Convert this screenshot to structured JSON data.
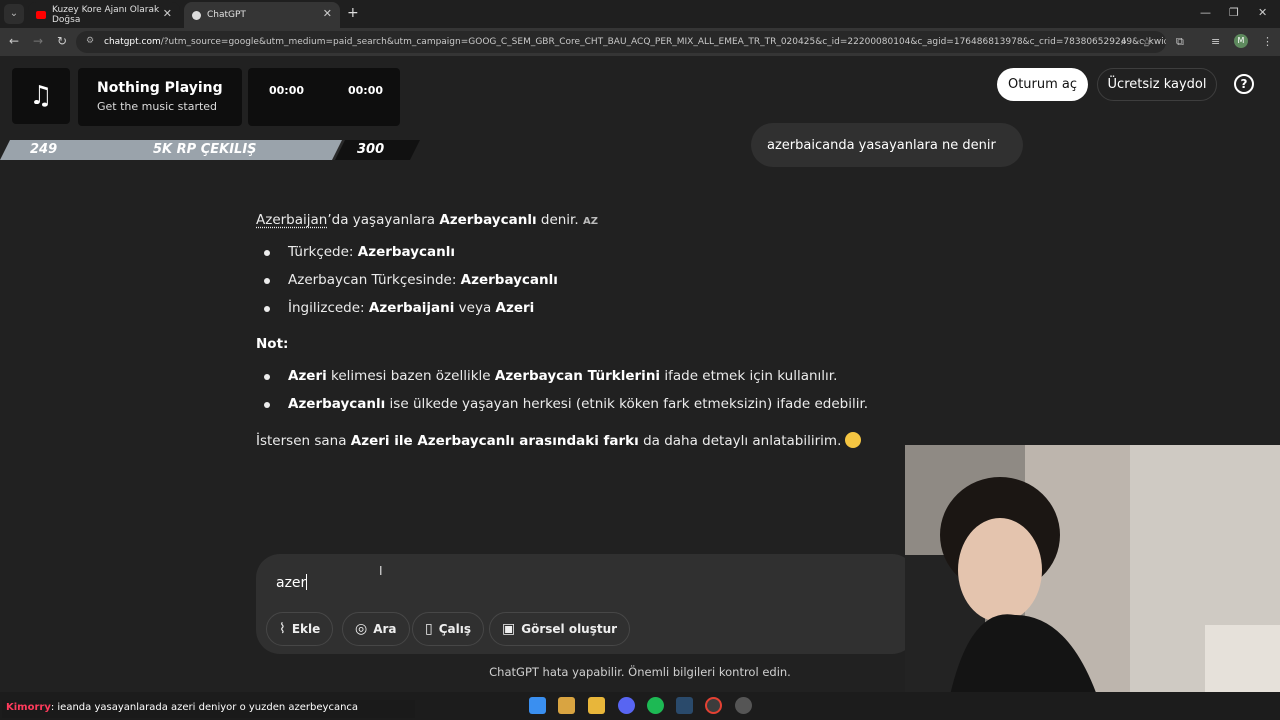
{
  "browser": {
    "tabs": [
      {
        "title": "Kuzey Kore Ajanı Olarak Doğsa",
        "close": "✕"
      },
      {
        "title": "ChatGPT",
        "close": "✕"
      }
    ],
    "new_tab": "+",
    "url_host": "chatgpt.com",
    "url_rest": "/?utm_source=google&utm_medium=paid_search&utm_campaign=GOOG_C_SEM_GBR_Core_CHT_BAU_ACQ_PER_MIX_ALL_EMEA_TR_TR_020425&c_id=22200080104&c_agid=176486813978&c_crid=783806529249&c_kwid={keyw...",
    "window_controls": {
      "minimize": "—",
      "restore": "❐",
      "close": "✕"
    },
    "avatar_letter": "M"
  },
  "music": {
    "icon": "music-note-icon",
    "title": "Nothing Playing",
    "subtitle": "Get the music started",
    "time_start": "00:00",
    "time_end": "00:00"
  },
  "rp_bar": {
    "left": "249",
    "middle": "5K RP ÇEKILIŞ",
    "right": "300",
    "progress_fraction": 0.83
  },
  "header": {
    "login": "Oturum aç",
    "signup": "Ücretsiz kaydol",
    "help": "?"
  },
  "chat": {
    "user_message": "azerbaicanda yasayanlara ne denir",
    "answer": {
      "intro_link": "Azerbaijan",
      "intro_rest1": "’da yaşayanlara ",
      "intro_bold": "Azerbaycanlı",
      "intro_rest2": " denir. ",
      "intro_flag": "AZ",
      "bullets1": [
        {
          "pre": "Türkçede: ",
          "bold": "Azerbaycanlı",
          "mid": "",
          "bold2": ""
        },
        {
          "pre": "Azerbaycan Türkçesinde: ",
          "bold": "Azerbaycanlı",
          "mid": "",
          "bold2": ""
        },
        {
          "pre": "İngilizcede: ",
          "bold": "Azerbaijani",
          "mid": " veya ",
          "bold2": "Azeri"
        }
      ],
      "note_heading": "Not:",
      "bullets2": [
        {
          "bold": "Azeri",
          "mid": " kelimesi bazen özellikle ",
          "bold2": "Azerbaycan Türklerini",
          "post": " ifade etmek için kullanılır."
        },
        {
          "bold": "Azerbaycanlı",
          "mid": " ise ülkede yaşayan herkesi (etnik köken fark etmeksizin) ifade edebilir.",
          "bold2": "",
          "post": ""
        }
      ],
      "closing_pre": "İstersen sana ",
      "closing_bold": "Azeri ile Azerbaycanlı arasındaki farkı",
      "closing_post": " da daha detaylı anlatabilirim."
    }
  },
  "composer": {
    "input_value": "azer",
    "buttons": [
      {
        "icon": "paperclip-icon",
        "label": "Ekle"
      },
      {
        "icon": "globe-icon",
        "label": "Ara"
      },
      {
        "icon": "book-icon",
        "label": "Çalış"
      },
      {
        "icon": "image-icon",
        "label": "Görsel oluştur"
      }
    ],
    "disclaimer": "ChatGPT hata yapabilir. Önemli bilgileri kontrol edin."
  },
  "stream_chat": {
    "user": "Kimorry",
    "message": ": ieanda yasayanlarada azeri deniyor o yuzden azerbeycanca"
  },
  "colors": {
    "background": "#212121",
    "bubble": "#303030",
    "accent_red": "#ff3b5c"
  }
}
